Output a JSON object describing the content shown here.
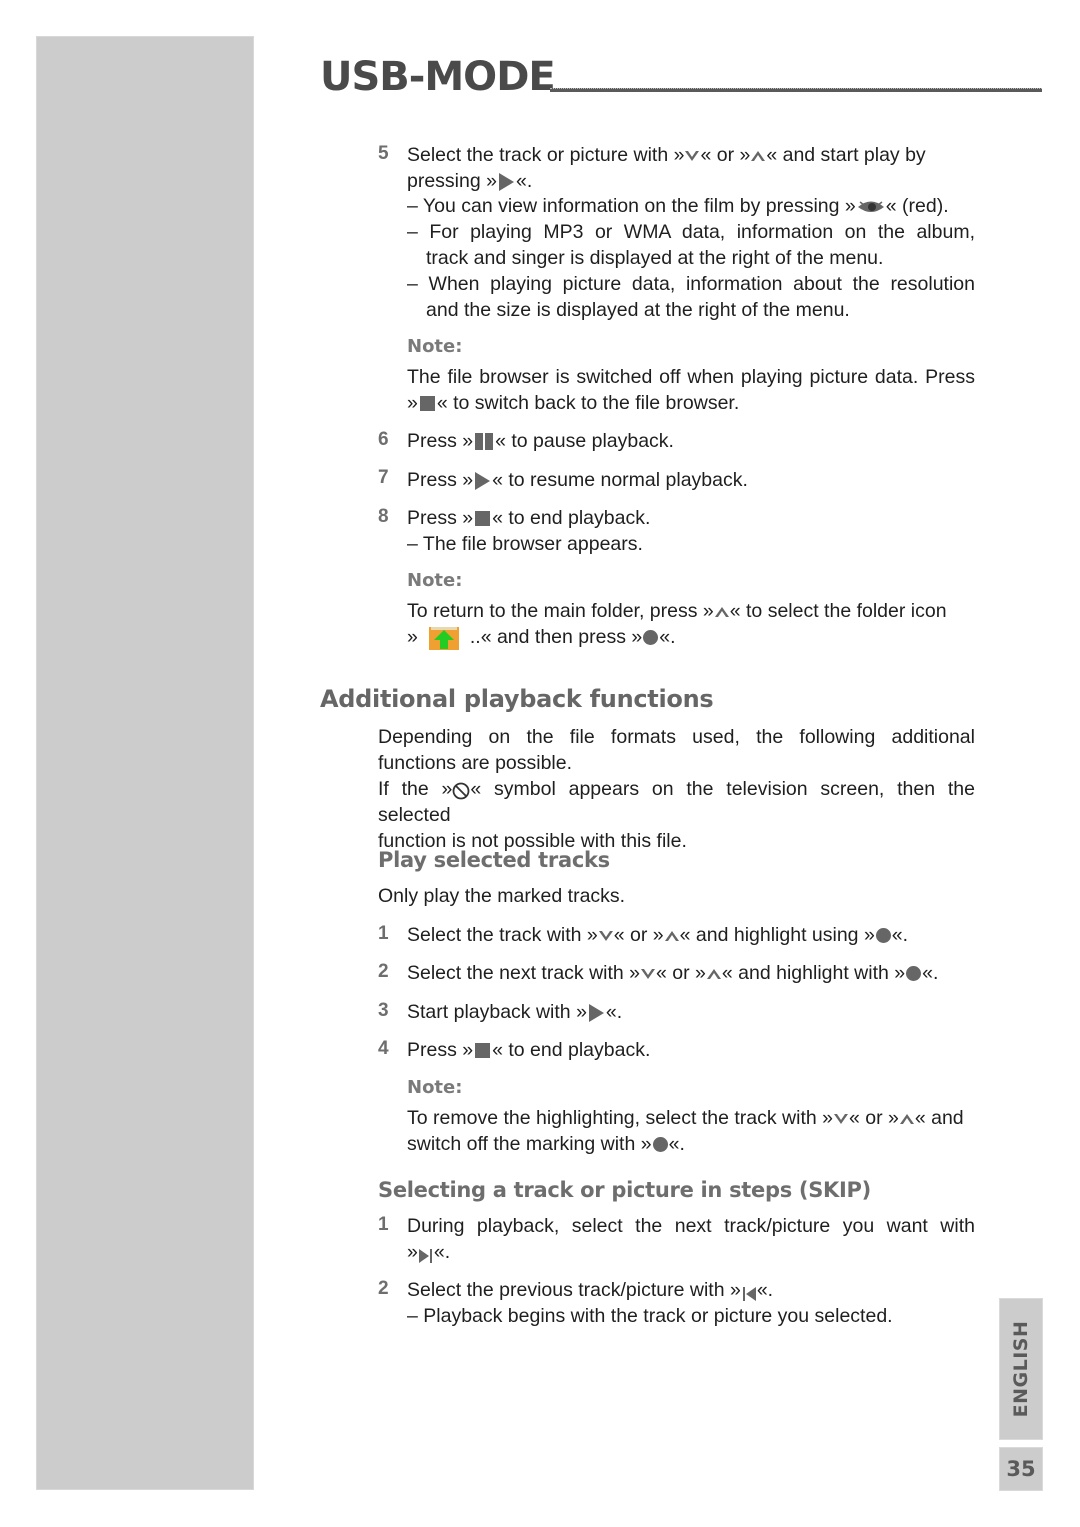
{
  "header": {
    "title": "USB-MODE"
  },
  "step5": {
    "number": "5",
    "a": "Select the track or picture with »",
    "b": "« or »",
    "c": "« and start play by",
    "d": "pressing »",
    "e": "«.",
    "sub1a": "– You can view information on the film by pressing »",
    "sub1b": "« (red).",
    "sub2": "– For playing MP3 or WMA data, information on the album,",
    "sub2b": "track and singer is displayed at the right of the menu.",
    "sub3": "– When playing picture data, information about the resolution",
    "sub3b": "and the size is displayed at the right of the menu."
  },
  "note1": {
    "label": "Note:",
    "line1": "The file browser is switched off when playing picture data. Press",
    "line2a": "»",
    "line2b": "« to switch back to the file browser."
  },
  "step6": {
    "number": "6",
    "a": "Press »",
    "b": "« to pause playback."
  },
  "step7": {
    "number": "7",
    "a": "Press »",
    "b": "« to resume normal playback."
  },
  "step8": {
    "number": "8",
    "a": "Press »",
    "b": "« to end playback.",
    "sub": "– The file browser appears."
  },
  "note2": {
    "label": "Note:",
    "line1a": "To return to the main folder, press »",
    "line1b": "« to select the folder icon",
    "line2a": "»",
    "line2b": "..« and then press »",
    "line2c": "«."
  },
  "section": {
    "title": "Additional playback functions",
    "p1": "Depending on the file formats used, the following additional",
    "p1b": "functions are possible.",
    "p2a": "If the »",
    "p2b": "« symbol appears on the television screen, then the selected",
    "p2c": "function is not possible with this file."
  },
  "play_selected": {
    "title": "Play selected tracks",
    "intro": "Only play the marked tracks.",
    "s1": {
      "number": "1",
      "a": "Select the track with »",
      "b": "« or »",
      "c": "« and highlight using »",
      "d": "«."
    },
    "s2": {
      "number": "2",
      "a": "Select the next track with »",
      "b": "« or »",
      "c": "« and highlight with »",
      "d": "«."
    },
    "s3": {
      "number": "3",
      "a": "Start playback with »",
      "b": "«."
    },
    "s4": {
      "number": "4",
      "a": "Press »",
      "b": "« to end playback."
    },
    "note": {
      "label": "Note:",
      "a": "To remove the highlighting, select the track with »",
      "b": "« or »",
      "c": "« and",
      "d": "switch off the marking with »",
      "e": "«."
    }
  },
  "skip": {
    "title": "Selecting a track or picture in steps (SKIP)",
    "s1": {
      "number": "1",
      "a": "During playback, select the next track/picture you want with",
      "b": "»",
      "c": "«."
    },
    "s2": {
      "number": "2",
      "a": "Select the previous track/picture with »",
      "b": "«.",
      "sub": "– Playback begins with the track or picture you selected."
    }
  },
  "side_tab": {
    "language": "ENGLISH",
    "page": "35"
  },
  "colors": {
    "sidebar": "#cccccc",
    "heading": "#666666",
    "folder_orange": "#f0a030",
    "folder_arrow": "#22cc22"
  }
}
